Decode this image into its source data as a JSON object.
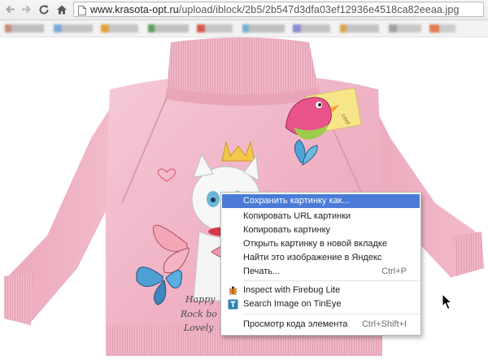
{
  "browser": {
    "url_host": "www.krasota-opt.ru",
    "url_path": "/upload/iblock/2b5/2b547d3dfa03ef12936e4518ca82eeaa.jpg",
    "nav_icons": [
      "back-icon",
      "forward-icon",
      "reload-icon",
      "home-icon"
    ],
    "page_icon": "page-icon"
  },
  "image": {
    "shirt_print_text": [
      "Happy",
      "Rock bo",
      "Lovely"
    ],
    "tag_text": "cool"
  },
  "context_menu": {
    "items": [
      {
        "label": "Сохранить картинку как...",
        "shortcut": "",
        "highlighted": true
      },
      {
        "label": "Копировать URL картинки",
        "shortcut": ""
      },
      {
        "label": "Копировать картинку",
        "shortcut": ""
      },
      {
        "label": "Открыть картинку в новой вкладке",
        "shortcut": ""
      },
      {
        "label": "Найти это изображение в Яндекс",
        "shortcut": ""
      },
      {
        "label": "Печать...",
        "shortcut": "Ctrl+P"
      },
      {
        "label": "Inspect with Firebug Lite",
        "shortcut": "",
        "icon": "firebug-icon"
      },
      {
        "label": "Search Image on TinEye",
        "shortcut": "",
        "icon": "tineye-icon"
      },
      {
        "label": "Просмотр кода элемента",
        "shortcut": "Ctrl+Shift+I"
      }
    ]
  },
  "colors": {
    "menu_highlight": "#4a7bd6",
    "sweater_pink": "#f0b8c8"
  }
}
